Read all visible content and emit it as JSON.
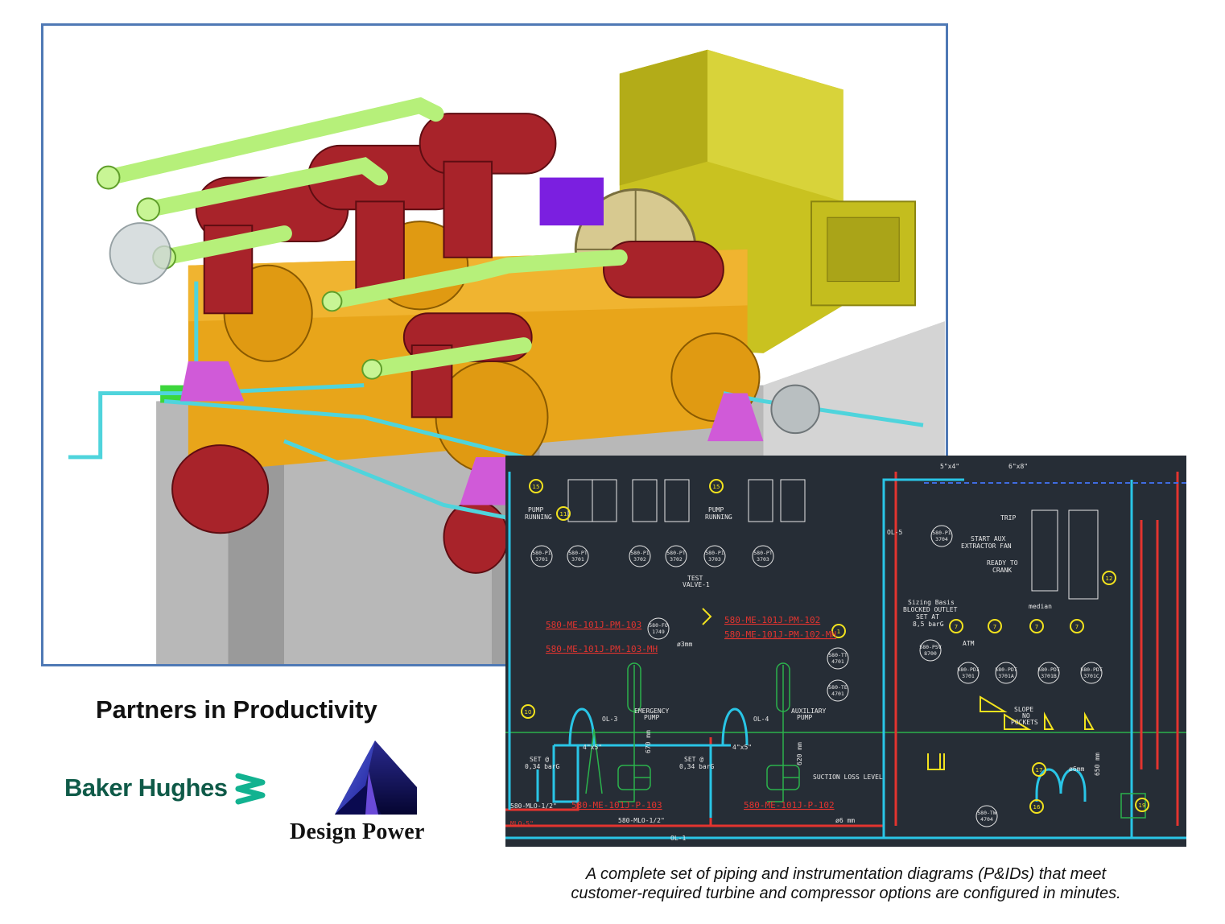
{
  "tagline": "Partners in Productivity",
  "logos": {
    "baker_hughes": "Baker Hughes",
    "design_power": "Design Power"
  },
  "caption": {
    "line1": "A complete set of piping and instrumentation diagrams (P&IDs) that meet",
    "line2": "customer-required turbine and compressor options are configured in minutes."
  },
  "pid": {
    "labels": {
      "pump_running_1": "PUMP",
      "pump_running_1b": "RUNNING",
      "pump_running_2": "PUMP",
      "pump_running_2b": "RUNNING",
      "test_valve": "TEST",
      "test_valve_b": "VALVE-1",
      "emergency_pump": "EMERGENCY",
      "emergency_pump_b": "PUMP",
      "auxiliary_pump": "AUXILIARY",
      "auxiliary_pump_b": "PUMP",
      "suction_loss": "SUCTION LOSS LEVEL",
      "trip": "TRIP",
      "start_aux": "START AUX",
      "start_aux_b": "EXTRACTOR FAN",
      "ready": "READY TO",
      "ready_b": "CRANK",
      "sizing": "Sizing Basis",
      "sizing_b": "BLOCKED OUTLET",
      "sizing_c": "SET AT",
      "sizing_d": "8,5 barG",
      "median": "median",
      "slope_1": "SLOPE",
      "slope_2": "NO",
      "slope_3": "POCKETS",
      "set_1": "SET @",
      "set_1b": "0,34 barG",
      "set_2": "SET @",
      "set_2b": "0,34 barG",
      "atm": "ATM",
      "ol1": "OL-1",
      "ol3": "OL-3",
      "ol4": "OL-4",
      "ol5": "OL-5",
      "mlo_bottom": "580-MLO-1/2\"",
      "mlo_left": "580-MLO-1/2\"",
      "mlo5": "MLO-5\"",
      "dim670": "670 mm",
      "dim620": "620 mm",
      "dim650": "650 mm",
      "phi3": "ø3mm",
      "phi6": "ø6 mm",
      "phi6b": "ø6mm",
      "size1": "5\"x4\"",
      "size2": "6\"x8\"",
      "size3": "4\"x5\"",
      "size4": "4\"x5\""
    },
    "red_tags": {
      "pm103": "580-ME-101J-PM-103",
      "pm103mh": "580-ME-101J-PM-103-MH",
      "pm102": "580-ME-101J-PM-102",
      "pm102mh": "580-ME-101J-PM-102-MH",
      "p103": "580-ME-101J-P-103",
      "p102": "580-ME-101J-P-102"
    },
    "instruments": {
      "pi3701a": "580-PI",
      "pi3701a_n": "3701",
      "pt3701": "580-PT",
      "pt3701_n": "3701",
      "pi3702": "580-PI",
      "pi3702_n": "3702",
      "pt3702": "580-PT",
      "pt3702_n": "3702",
      "pi3703": "580-PI",
      "pi3703_n": "3703",
      "pt3703": "580-PT",
      "pt3703_n": "3703",
      "fo1749": "580-FO",
      "fo1749_n": "1749",
      "tt4701": "580-TT",
      "tt4701_n": "4701",
      "te4701": "580-TE",
      "te4701_n": "4701",
      "psv8700": "580-PSV",
      "psv8700_n": "8700",
      "pi3704": "580-PI",
      "pi3704_n": "3704",
      "tw4704": "580-TW",
      "tw4704_n": "4704",
      "pdi3701": "580-PDI",
      "pdi3701_n": "3701",
      "pdt3701a": "580-PDT",
      "pdt3701a_n": "3701A",
      "pdt3701b": "580-PDT",
      "pdt3701b_n": "3701B",
      "pdt3701c": "580-PDT",
      "pdt3701c_n": "3701C"
    },
    "balloons": [
      "15",
      "11",
      "15",
      "10",
      "1",
      "7",
      "7",
      "7",
      "7",
      "12",
      "17",
      "16",
      "19"
    ]
  }
}
